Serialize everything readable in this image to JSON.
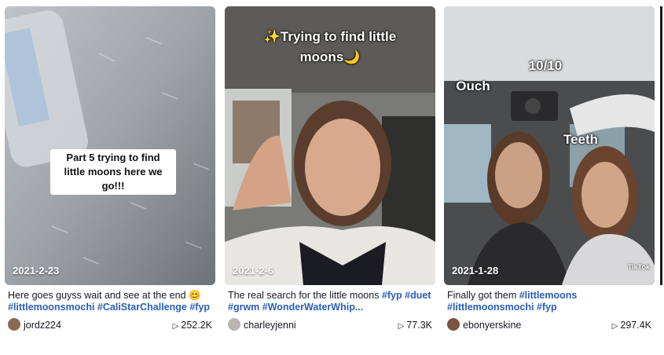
{
  "cards": [
    {
      "date": "2021-2-23",
      "overlay": "Part 5 trying to find little moons here we go!!!",
      "caption_text": "Here goes guyss wait and see at the end 😊",
      "tags": [
        "#littlemoonsmochi",
        "#CaliStarChallenge",
        "#fyp"
      ],
      "author": "jordz224",
      "views": "252.2K"
    },
    {
      "date": "2021-2-6",
      "overlay": "✨Trying to find little moons🌙",
      "caption_text": "The real search for the little moons",
      "tags": [
        "#fyp",
        "#duet",
        "#grwm",
        "#WonderWaterWhip..."
      ],
      "author": "charleyjenni",
      "views": "77.3K"
    },
    {
      "date": "2021-1-28",
      "overlay_labels": [
        "10/10",
        "Ouch",
        "Teeth"
      ],
      "watermark": "TikTok",
      "caption_text": "Finally got them",
      "tags": [
        "#littlemoons",
        "#littlemoonsmochi",
        "#fyp"
      ],
      "author": "ebonyerskine",
      "views": "297.4K"
    }
  ],
  "icons": {
    "play": "play-icon",
    "avatar": "avatar"
  }
}
